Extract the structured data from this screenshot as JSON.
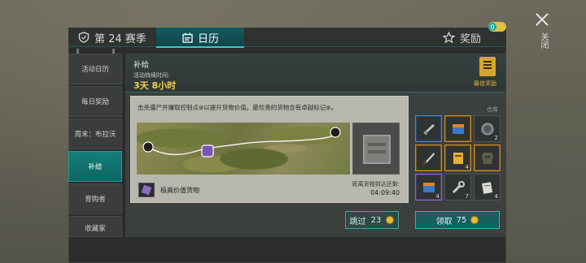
{
  "close": {
    "label": "关闭"
  },
  "tabs": {
    "season": "第 24 赛季",
    "calendar": "日历",
    "reward": "奖励",
    "reward_badge": "0"
  },
  "nav": {
    "items": [
      {
        "label": "活动日历"
      },
      {
        "label": "每日奖励"
      },
      {
        "label": "周末：布拉沃"
      },
      {
        "label": "补给"
      },
      {
        "label": "育购者"
      },
      {
        "label": "收藏家"
      }
    ],
    "active_index": 3
  },
  "event": {
    "title": "补给",
    "duration_label": "活动持续时间:",
    "duration_value": "3天 8小时",
    "best_reward_label": "最佳奖励"
  },
  "mission": {
    "description": "击杀僵尸并赚取控制点⊛以提升货物价值。最珍贵的货物含有卓越标记⊛。",
    "cargo_label": "极高价值货物",
    "distance_label": "距离货物到达还剩:",
    "distance_time": "04:09:40"
  },
  "skip": {
    "label": "跳过",
    "cost": "23"
  },
  "warehouse": {
    "label": "仓库",
    "items": [
      {
        "icon": "rifle-icon",
        "count": "",
        "rarity": "blue"
      },
      {
        "icon": "supply-crate-icon",
        "count": "",
        "rarity": "gold"
      },
      {
        "icon": "frying-pan-icon",
        "count": "2",
        "rarity": "none"
      },
      {
        "icon": "machete-icon",
        "count": "",
        "rarity": "gold"
      },
      {
        "icon": "manual-book-icon",
        "count": "4",
        "rarity": "gold"
      },
      {
        "icon": "body-armor-icon",
        "count": "",
        "rarity": "gold"
      },
      {
        "icon": "loot-crate-icon",
        "count": "4",
        "rarity": "purple"
      },
      {
        "icon": "wrench-tools-icon",
        "count": "7",
        "rarity": "none"
      },
      {
        "icon": "documents-icon",
        "count": "4",
        "rarity": "none"
      }
    ]
  },
  "claim": {
    "label": "领取",
    "cost": "75"
  },
  "colors": {
    "accent": "#1a9c98",
    "gold": "#e9b739",
    "highlight": "#f2d24a"
  }
}
